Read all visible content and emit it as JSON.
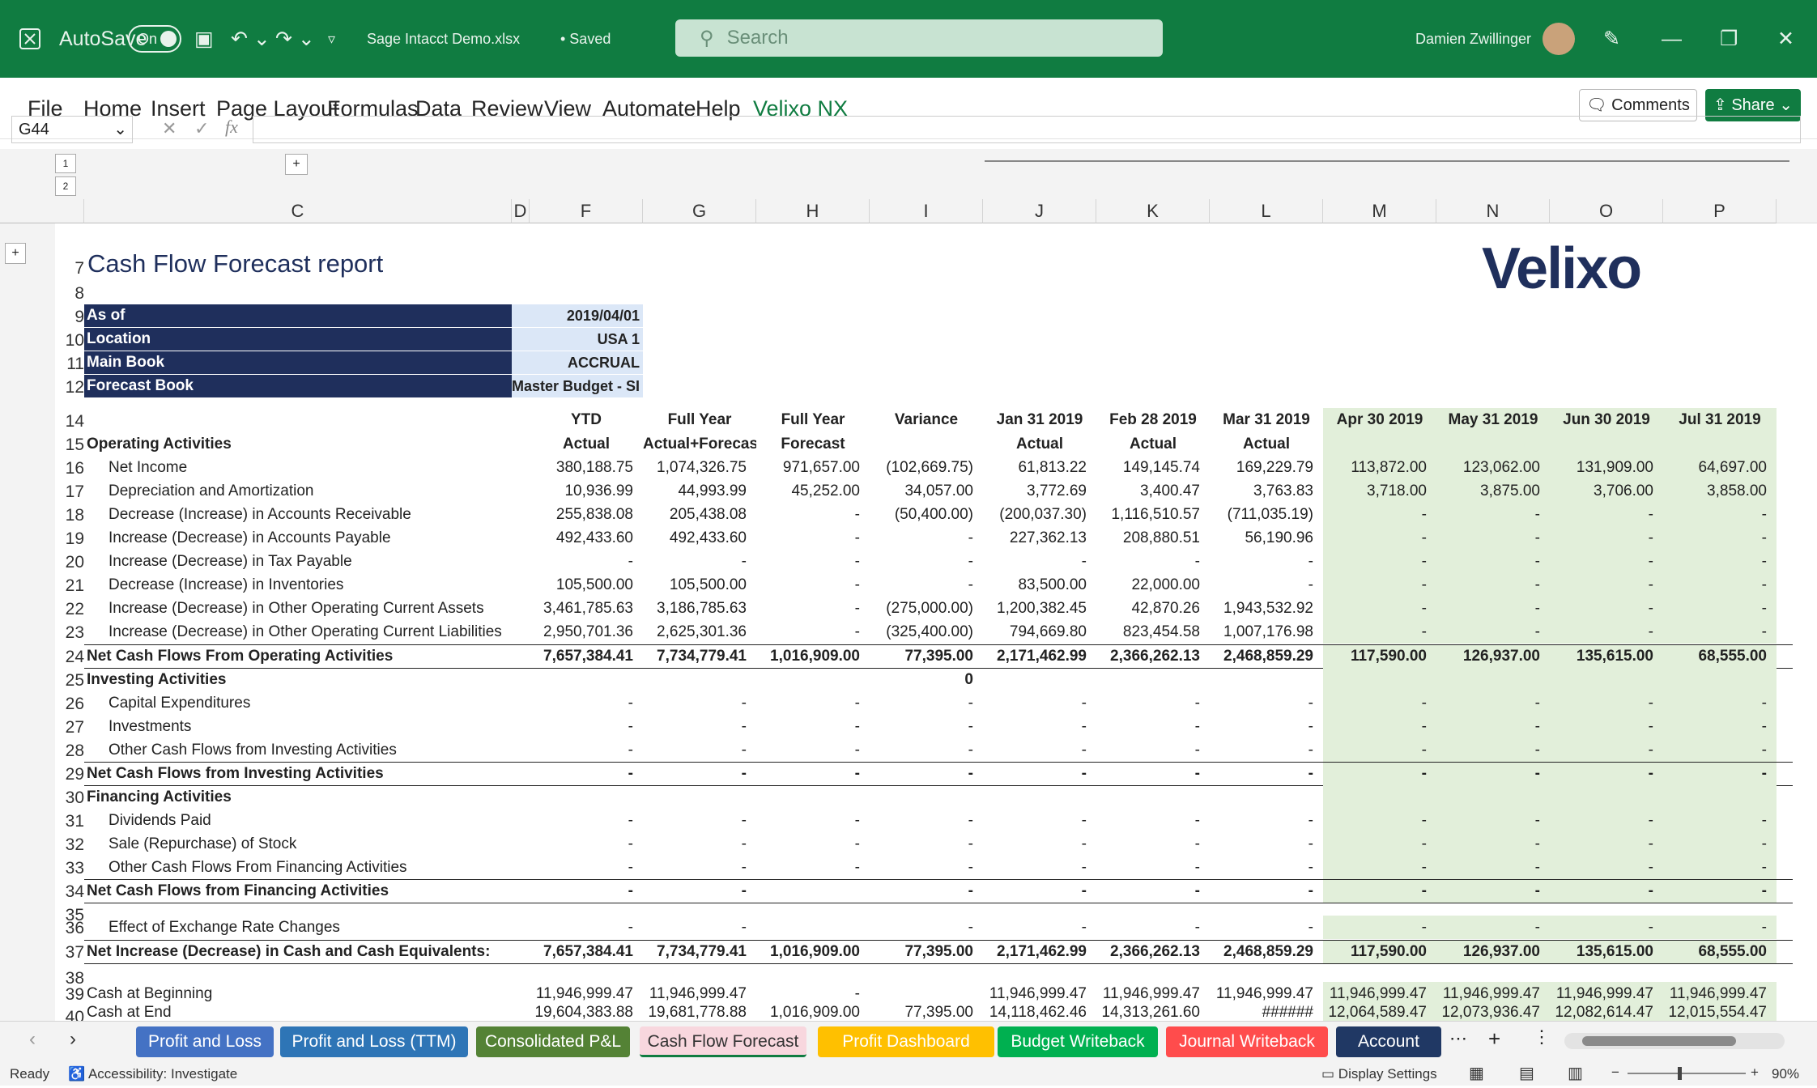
{
  "titlebar": {
    "autosave": "AutoSave",
    "toggle": "On",
    "filename": "Sage Intacct Demo.xlsx",
    "saved": "• Saved",
    "search": "Search",
    "user": "Damien Zwillinger"
  },
  "menu": [
    "File",
    "Home",
    "Insert",
    "Page Layout",
    "Formulas",
    "Data",
    "Review",
    "View",
    "Automate",
    "Help",
    "Velixo NX"
  ],
  "buttons": {
    "comments": "Comments",
    "share": "Share"
  },
  "namebox": "G44",
  "fx": "fx",
  "outline_levels": [
    "1",
    "2"
  ],
  "columns": [
    "C",
    "D",
    "F",
    "G",
    "H",
    "I",
    "J",
    "K",
    "L",
    "M",
    "N",
    "O",
    "P"
  ],
  "title": "Cash Flow Forecast report",
  "logo": "Velixo",
  "params": [
    [
      "As of",
      "2019/04/01"
    ],
    [
      "Location",
      "USA 1"
    ],
    [
      "Main Book",
      "ACCRUAL"
    ],
    [
      "Forecast Book",
      "Master Budget - SI"
    ]
  ],
  "headers1": [
    "YTD",
    "Full Year",
    "Full Year",
    "Variance",
    "Jan 31 2019",
    "Feb 28 2019",
    "Mar 31 2019",
    "Apr 30 2019",
    "May 31 2019",
    "Jun 30 2019",
    "Jul 31 2019"
  ],
  "headers2": [
    "Actual",
    "Actual+Forecast",
    "Forecast",
    "",
    "Actual",
    "Actual",
    "Actual",
    "Forecast",
    "Forecast",
    "Forecast",
    "Forecast"
  ],
  "rows": [
    {
      "n": "15",
      "label": "Operating Activities",
      "b": true,
      "vals": []
    },
    {
      "n": "16",
      "label": "Net Income",
      "i": true,
      "vals": [
        "380,188.75",
        "1,074,326.75",
        "971,657.00",
        "(102,669.75)",
        "61,813.22",
        "149,145.74",
        "169,229.79",
        "113,872.00",
        "123,062.00",
        "131,909.00",
        "64,697.00"
      ]
    },
    {
      "n": "17",
      "label": "Depreciation and Amortization",
      "i": true,
      "vals": [
        "10,936.99",
        "44,993.99",
        "45,252.00",
        "34,057.00",
        "3,772.69",
        "3,400.47",
        "3,763.83",
        "3,718.00",
        "3,875.00",
        "3,706.00",
        "3,858.00"
      ]
    },
    {
      "n": "18",
      "label": "Decrease (Increase) in Accounts Receivable",
      "i": true,
      "vals": [
        "255,838.08",
        "205,438.08",
        "-",
        "(50,400.00)",
        "(200,037.30)",
        "1,116,510.57",
        "(711,035.19)",
        "-",
        "-",
        "-",
        "-"
      ]
    },
    {
      "n": "19",
      "label": "Increase (Decrease) in Accounts Payable",
      "i": true,
      "vals": [
        "492,433.60",
        "492,433.60",
        "-",
        "-",
        "227,362.13",
        "208,880.51",
        "56,190.96",
        "-",
        "-",
        "-",
        "-"
      ]
    },
    {
      "n": "20",
      "label": "Increase (Decrease) in Tax Payable",
      "i": true,
      "vals": [
        "-",
        "-",
        "-",
        "-",
        "-",
        "-",
        "-",
        "-",
        "-",
        "-",
        "-"
      ]
    },
    {
      "n": "21",
      "label": "Decrease (Increase) in Inventories",
      "i": true,
      "vals": [
        "105,500.00",
        "105,500.00",
        "-",
        "-",
        "83,500.00",
        "22,000.00",
        "-",
        "-",
        "-",
        "-",
        "-"
      ]
    },
    {
      "n": "22",
      "label": "Increase (Decrease) in Other Operating Current Assets",
      "i": true,
      "vals": [
        "3,461,785.63",
        "3,186,785.63",
        "-",
        "(275,000.00)",
        "1,200,382.45",
        "42,870.26",
        "1,943,532.92",
        "-",
        "-",
        "-",
        "-"
      ]
    },
    {
      "n": "23",
      "label": "Increase (Decrease) in Other Operating Current Liabilities",
      "i": true,
      "vals": [
        "2,950,701.36",
        "2,625,301.36",
        "-",
        "(325,400.00)",
        "794,669.80",
        "823,454.58",
        "1,007,176.98",
        "-",
        "-",
        "-",
        "-"
      ]
    },
    {
      "n": "24",
      "label": "Net Cash Flows From Operating Activities",
      "b": true,
      "tot": true,
      "vals": [
        "7,657,384.41",
        "7,734,779.41",
        "1,016,909.00",
        "77,395.00",
        "2,171,462.99",
        "2,366,262.13",
        "2,468,859.29",
        "117,590.00",
        "126,937.00",
        "135,615.00",
        "68,555.00"
      ]
    },
    {
      "n": "25",
      "label": "Investing Activities",
      "b": true,
      "vals": [
        "",
        "",
        "",
        "0"
      ]
    },
    {
      "n": "26",
      "label": "Capital Expenditures",
      "i": true,
      "vals": [
        "-",
        "-",
        "-",
        "-",
        "-",
        "-",
        "-",
        "-",
        "-",
        "-",
        "-"
      ]
    },
    {
      "n": "27",
      "label": "Investments",
      "i": true,
      "vals": [
        "-",
        "-",
        "-",
        "-",
        "-",
        "-",
        "-",
        "-",
        "-",
        "-",
        "-"
      ]
    },
    {
      "n": "28",
      "label": "Other Cash Flows from Investing Activities",
      "i": true,
      "vals": [
        "-",
        "-",
        "-",
        "-",
        "-",
        "-",
        "-",
        "-",
        "-",
        "-",
        "-"
      ]
    },
    {
      "n": "29",
      "label": "Net Cash Flows from Investing Activities",
      "b": true,
      "tot": true,
      "vals": [
        "-",
        "-",
        "-",
        "-",
        "-",
        "-",
        "-",
        "-",
        "-",
        "-",
        "-"
      ]
    },
    {
      "n": "30",
      "label": "Financing Activities",
      "b": true,
      "vals": []
    },
    {
      "n": "31",
      "label": "Dividends Paid",
      "i": true,
      "vals": [
        "-",
        "-",
        "-",
        "-",
        "-",
        "-",
        "-",
        "-",
        "-",
        "-",
        "-"
      ]
    },
    {
      "n": "32",
      "label": "Sale (Repurchase) of Stock",
      "i": true,
      "vals": [
        "-",
        "-",
        "-",
        "-",
        "-",
        "-",
        "-",
        "-",
        "-",
        "-",
        "-"
      ]
    },
    {
      "n": "33",
      "label": "Other Cash Flows From Financing Activities",
      "i": true,
      "vals": [
        "-",
        "-",
        "-",
        "-",
        "-",
        "-",
        "-",
        "-",
        "-",
        "-",
        "-"
      ]
    },
    {
      "n": "34",
      "label": "Net Cash Flows from Financing Activities",
      "b": true,
      "tot": true,
      "vals": [
        "-",
        "-",
        "",
        "-",
        "-",
        "-",
        "-",
        "-",
        "-",
        "-",
        "-"
      ]
    },
    {
      "n": "36",
      "label": "Effect of Exchange Rate Changes",
      "i": true,
      "vals": [
        "-",
        "-",
        "",
        "-",
        "-",
        "-",
        "-",
        "-",
        "-",
        "-",
        "-"
      ]
    },
    {
      "n": "37",
      "label": "Net Increase (Decrease) in Cash and Cash Equivalents:",
      "b": true,
      "tot": true,
      "vals": [
        "7,657,384.41",
        "7,734,779.41",
        "1,016,909.00",
        "77,395.00",
        "2,171,462.99",
        "2,366,262.13",
        "2,468,859.29",
        "117,590.00",
        "126,937.00",
        "135,615.00",
        "68,555.00"
      ]
    },
    {
      "n": "39",
      "label": "Cash at Beginning",
      "vals": [
        "11,946,999.47",
        "11,946,999.47",
        "-",
        "",
        "11,946,999.47",
        "11,946,999.47",
        "11,946,999.47",
        "11,946,999.47",
        "11,946,999.47",
        "11,946,999.47",
        "11,946,999.47"
      ]
    },
    {
      "n": "40",
      "label": "Cash at End",
      "vals": [
        "19,604,383.88",
        "19,681,778.88",
        "1,016,909.00",
        "77,395.00",
        "14,118,462.46",
        "14,313,261.60",
        "######",
        "12,064,589.47",
        "12,073,936.47",
        "12,082,614.47",
        "12,015,554.47"
      ]
    }
  ],
  "tabs": [
    {
      "label": "Profit and Loss",
      "color": "#4472c4"
    },
    {
      "label": "Profit and Loss (TTM)",
      "color": "#2e75b6"
    },
    {
      "label": "Consolidated P&L",
      "color": "#548235"
    },
    {
      "label": "Cash Flow Forecast",
      "color": "#f4b6c2"
    },
    {
      "label": "Profit Dashboard",
      "color": "#ffc000"
    },
    {
      "label": "Budget Writeback",
      "color": "#00b050"
    },
    {
      "label": "Journal Writeback",
      "color": "#ff4c4c"
    },
    {
      "label": "Account Balan",
      "color": "#203864"
    }
  ],
  "status": {
    "ready": "Ready",
    "access": "Accessibility: Investigate",
    "display": "Display Settings",
    "zoom": "90%"
  }
}
